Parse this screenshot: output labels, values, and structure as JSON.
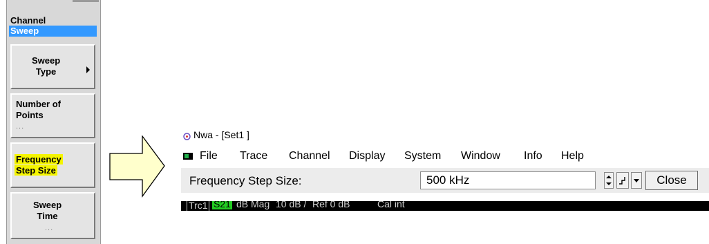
{
  "panel": {
    "title": "Channel",
    "subtitle": "Sweep",
    "softkeys": [
      {
        "line1": "Sweep",
        "line2": "Type",
        "has_submenu_arrow": true
      },
      {
        "line1": "Number of",
        "line2": "Points",
        "dots": "..."
      },
      {
        "line1": "Frequency",
        "line2": "Step Size",
        "highlight": "#f5f500"
      },
      {
        "line1": "Sweep",
        "line2": "Time",
        "dots": "..."
      }
    ]
  },
  "window": {
    "title": "Nwa - [Set1 ]",
    "menu": [
      "File",
      "Trace",
      "Channel",
      "Display",
      "System",
      "Window",
      "Info",
      "Help"
    ],
    "toolbar": {
      "label": "Frequency Step Size:",
      "value": "500 kHz",
      "close_label": "Close"
    },
    "tracebar": {
      "trace": "Trc1",
      "param": "S21",
      "format": "dB Mag",
      "scale": "10 dB /",
      "ref": "Ref 0 dB",
      "cal": "Cal int"
    }
  },
  "colors": {
    "selection_blue": "#3399ff",
    "highlight_yellow": "#f5f500",
    "arrow_fill": "#ffffcc",
    "s21_green": "#22cc22"
  }
}
